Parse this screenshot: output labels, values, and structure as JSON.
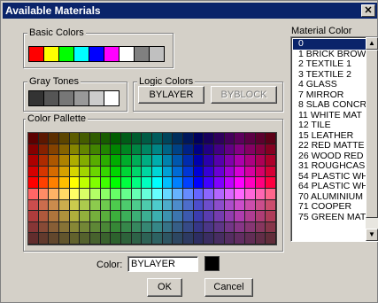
{
  "window": {
    "title": "Available Materials",
    "close_glyph": "✕"
  },
  "basic_colors": {
    "label": "Basic Colors",
    "swatches": [
      "#ff0000",
      "#ffff00",
      "#00ff00",
      "#00ffff",
      "#0000ff",
      "#ff00ff",
      "#ffffff",
      "#808080",
      "#c0c0c0"
    ]
  },
  "gray_tones": {
    "label": "Gray Tones",
    "swatches": [
      "#333333",
      "#555555",
      "#777777",
      "#999999",
      "#cccccc",
      "#ffffff"
    ]
  },
  "logic_colors": {
    "label": "Logic Colors",
    "bylayer_label": "BYLAYER",
    "byblock_label": "BYBLOCK"
  },
  "palette": {
    "label": "Color Pallette"
  },
  "color_field": {
    "label": "Color:",
    "value": "BYLAYER",
    "swatch_color": "#000000"
  },
  "buttons": {
    "ok_label": "OK",
    "cancel_label": "Cancel"
  },
  "material_color": {
    "label": "Material Color",
    "items": [
      "0",
      "1 BRICK BROW",
      "2 TEXTILE 1",
      "3 TEXTILE 2",
      "4 GLASS",
      "7 MIRROR",
      "8 SLAB CONCR",
      "11 WHITE MAT",
      "12 TILE",
      "15 LEATHER",
      "22 RED MATTE",
      "26 WOOD RED",
      "31 ROUGHCAS",
      "54 PLASTIC WH",
      "64 PLASTIC WH",
      "70 ALUMINIUM",
      "71 COOPER",
      "75 GREEN MAT"
    ],
    "selected_index": 0
  },
  "icons": {
    "scroll_up": "up-arrow",
    "scroll_down": "down-arrow",
    "close": "close-x"
  }
}
